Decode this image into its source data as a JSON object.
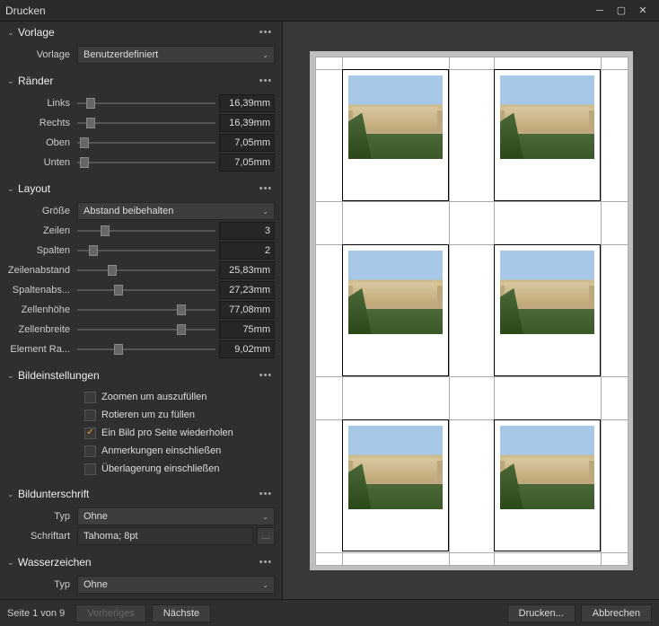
{
  "window": {
    "title": "Drucken"
  },
  "sections": {
    "vorlage": {
      "title": "Vorlage",
      "label": "Vorlage",
      "value": "Benutzerdefiniert"
    },
    "raender": {
      "title": "Ränder",
      "items": {
        "links": {
          "label": "Links",
          "value": "16,39mm",
          "pos": 10
        },
        "rechts": {
          "label": "Rechts",
          "value": "16,39mm",
          "pos": 10
        },
        "oben": {
          "label": "Oben",
          "value": "7,05mm",
          "pos": 5
        },
        "unten": {
          "label": "Unten",
          "value": "7,05mm",
          "pos": 5
        }
      }
    },
    "layout": {
      "title": "Layout",
      "groesse_label": "Größe",
      "groesse_value": "Abstand beibehalten",
      "items": {
        "zeilen": {
          "label": "Zeilen",
          "value": "3",
          "pos": 20
        },
        "spalten": {
          "label": "Spalten",
          "value": "2",
          "pos": 12
        },
        "zeilenabstand": {
          "label": "Zeilenabstand",
          "value": "25,83mm",
          "pos": 25
        },
        "spaltenabs": {
          "label": "Spaltenabs...",
          "value": "27,23mm",
          "pos": 30
        },
        "zellenhoehe": {
          "label": "Zellenhöhe",
          "value": "77,08mm",
          "pos": 75
        },
        "zellenbreite": {
          "label": "Zellenbreite",
          "value": "75mm",
          "pos": 75
        },
        "elementra": {
          "label": "Element Ra...",
          "value": "9,02mm",
          "pos": 30
        }
      }
    },
    "bild": {
      "title": "Bildeinstellungen",
      "checks": {
        "zoom": {
          "label": "Zoomen um auszufüllen",
          "checked": false
        },
        "rotate": {
          "label": "Rotieren um zu füllen",
          "checked": false
        },
        "repeat": {
          "label": "Ein Bild pro Seite wiederholen",
          "checked": true
        },
        "annot": {
          "label": "Anmerkungen einschließen",
          "checked": false
        },
        "overlay": {
          "label": "Überlagerung einschließen",
          "checked": false
        }
      }
    },
    "caption": {
      "title": "Bildunterschrift",
      "typ_label": "Typ",
      "typ_value": "Ohne",
      "font_label": "Schriftart",
      "font_value": "Tahoma; 8pt"
    },
    "wasserzeichen": {
      "title": "Wasserzeichen",
      "typ_label": "Typ",
      "typ_value": "Ohne"
    }
  },
  "footer": {
    "status": "Seite 1 von 9",
    "prev": "Vorheriges",
    "next": "Nächste",
    "print": "Drucken...",
    "cancel": "Abbrechen"
  }
}
